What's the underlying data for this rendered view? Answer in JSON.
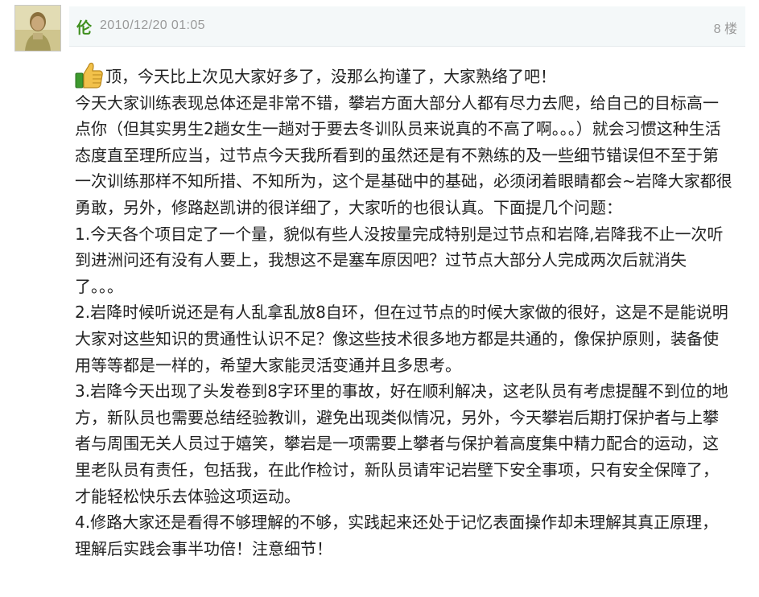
{
  "post": {
    "username": "伦",
    "timestamp": "2010/12/20 01:05",
    "floor": "8 楼",
    "emoji_icon": "thumbs-up-icon",
    "paragraphs": [
      "顶，今天比上次见大家好多了，没那么拘谨了，大家熟络了吧！",
      "今天大家训练表现总体还是非常不错，攀岩方面大部分人都有尽力去爬，给自己的目标高一点你（但其实男生2趟女生一趟对于要去冬训队员来说真的不高了啊。。。）就会习惯这种生活态度直至理所应当，过节点今天我所看到的虽然还是有不熟练的及一些细节错误但不至于第一次训练那样不知所措、不知所为，这个是基础中的基础，必须闭着眼睛都会~岩降大家都很勇敢，另外，修路赵凯讲的很详细了，大家听的也很认真。下面提几个问题：",
      "1.今天各个项目定了一个量，貌似有些人没按量完成特别是过节点和岩降,岩降我不止一次听到进洲问还有没有人要上，我想这不是塞车原因吧？过节点大部分人完成两次后就消失了。。。",
      "2.岩降时候听说还是有人乱拿乱放8自环，但在过节点的时候大家做的很好，这是不是能说明大家对这些知识的贯通性认识不足？像这些技术很多地方都是共通的，像保护原则，装备使用等等都是一样的，希望大家能灵活变通并且多思考。",
      "3.岩降今天出现了头发卷到8字环里的事故，好在顺利解决，这老队员有考虑提醒不到位的地方，新队员也需要总结经验教训，避免出现类似情况，另外，今天攀岩后期打保护者与上攀者与周围无关人员过于嬉笑，攀岩是一项需要上攀者与保护着高度集中精力配合的运动，这里老队员有责任，包括我，在此作检讨，新队员请牢记岩壁下安全事项，只有安全保障了，才能轻松快乐去体验这项运动。",
      "4.修路大家还是看得不够理解的不够，实践起来还处于记忆表面操作却未理解其真正原理，理解后实践会事半功倍！注意细节！"
    ]
  },
  "colors": {
    "username": "#3f8f1e",
    "meta_text": "#9a9a9a",
    "header_bg": "#f4f8f9",
    "body_text": "#222222"
  }
}
